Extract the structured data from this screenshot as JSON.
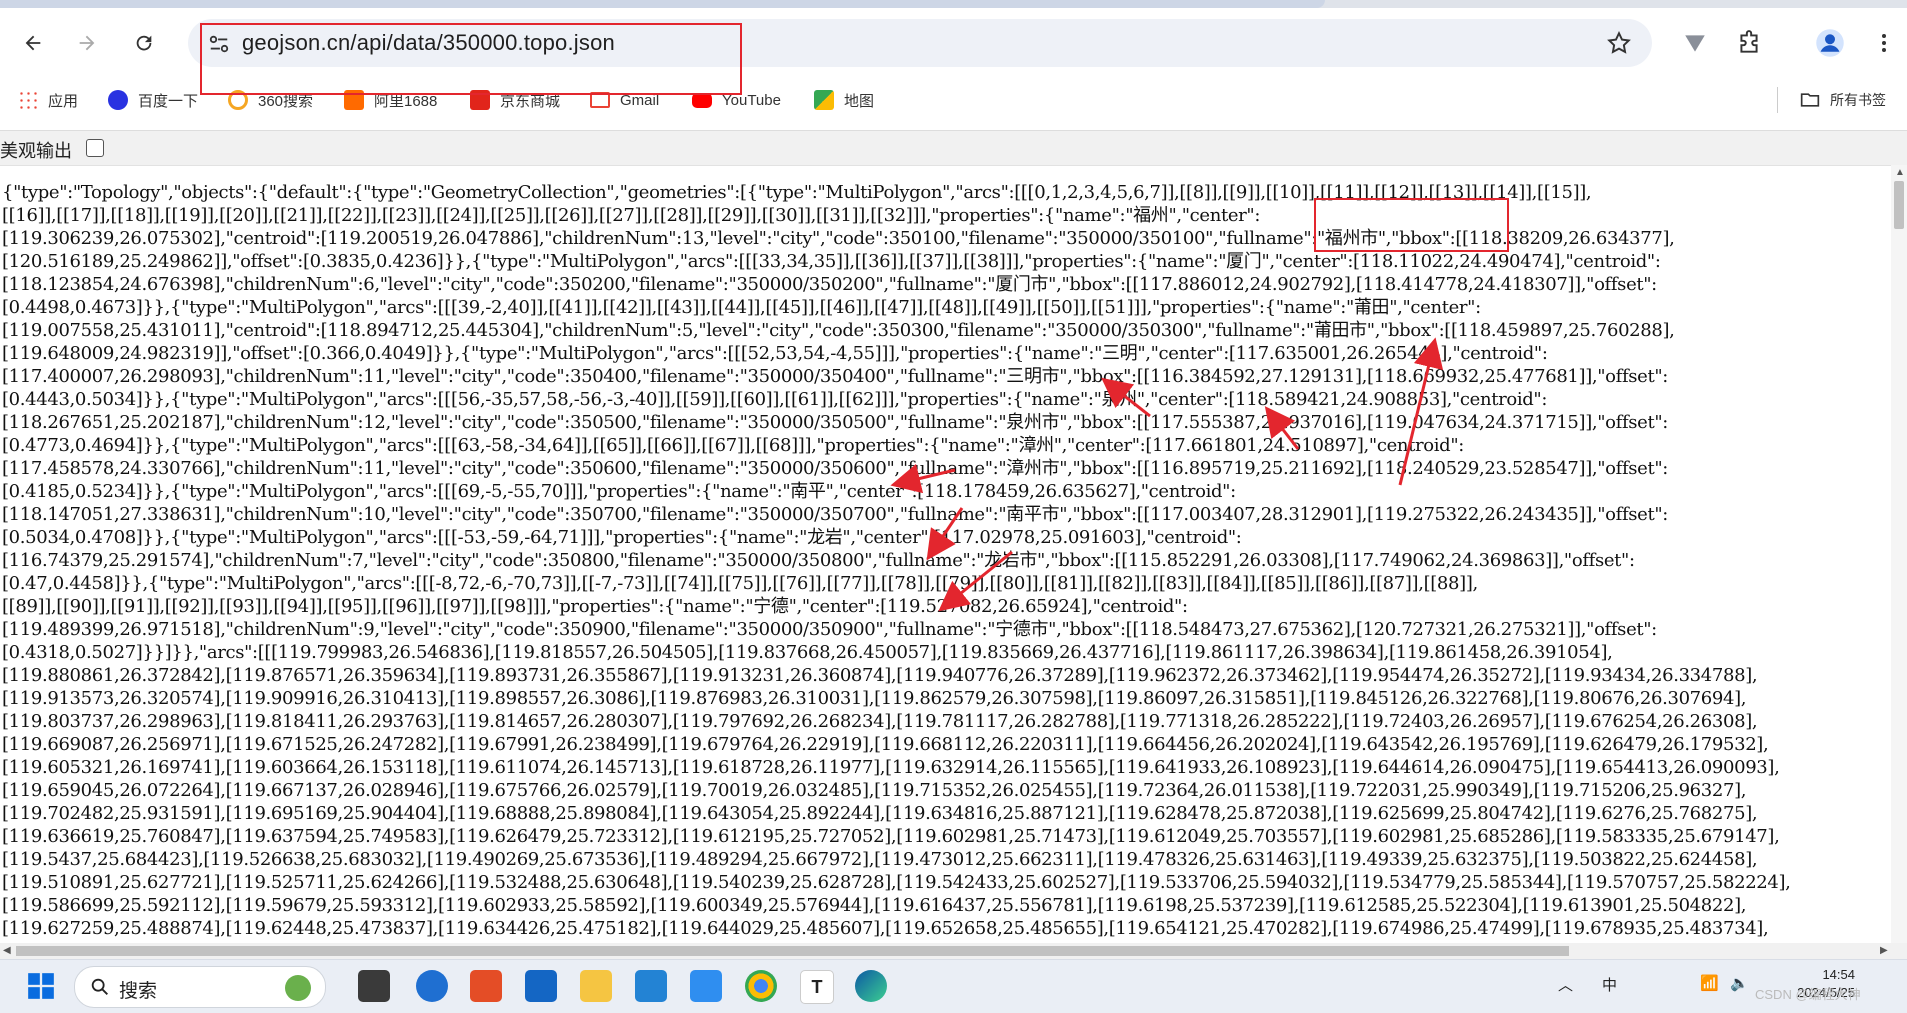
{
  "browser": {
    "url": "geojson.cn/api/data/350000.topo.json"
  },
  "bookmarks": [
    {
      "label": "应用",
      "color": "#4285f4"
    },
    {
      "label": "百度一下",
      "color": "#2932e1"
    },
    {
      "label": "360搜索",
      "color": "#f5a623"
    },
    {
      "label": "阿里1688",
      "color": "#ff6a00"
    },
    {
      "label": "京东商城",
      "color": "#e1251b"
    },
    {
      "label": "Gmail",
      "color": "#ea4335"
    },
    {
      "label": "YouTube",
      "color": "#ff0000"
    },
    {
      "label": "地图",
      "color": "#34a853"
    }
  ],
  "all_bookmarks_label": "所有书签",
  "pretty_print": {
    "label": "美观输出",
    "checked": false
  },
  "json_lines": [
    "{\"type\":\"Topology\",\"objects\":{\"default\":{\"type\":\"GeometryCollection\",\"geometries\":[{\"type\":\"MultiPolygon\",\"arcs\":[[[0,1,2,3,4,5,6,7]],[[8]],[[9]],[[10]],[[11]],[[12]],[[13]],[[14]],[[15]],",
    "[[16]],[[17]],[[18]],[[19]],[[20]],[[21]],[[22]],[[23]],[[24]],[[25]],[[26]],[[27]],[[28]],[[29]],[[30]],[[31]],[[32]]],\"properties\":{\"name\":\"福州\",\"center\":",
    "[119.306239,26.075302],\"centroid\":[119.200519,26.047886],\"childrenNum\":13,\"level\":\"city\",\"code\":350100,\"filename\":\"350000/350100\",\"fullname\":\"福州市\",\"bbox\":[[118.38209,26.634377],",
    "[120.516189,25.249862]],\"offset\":[0.3835,0.4236]}},{\"type\":\"MultiPolygon\",\"arcs\":[[[33,34,35]],[[36]],[[37]],[[38]]],\"properties\":{\"name\":\"厦门\",\"center\":[118.11022,24.490474],\"centroid\":",
    "[118.123854,24.676398],\"childrenNum\":6,\"level\":\"city\",\"code\":350200,\"filename\":\"350000/350200\",\"fullname\":\"厦门市\",\"bbox\":[[117.886012,24.902792],[118.414778,24.418307]],\"offset\":",
    "[0.4498,0.4673]}},{\"type\":\"MultiPolygon\",\"arcs\":[[[39,-2,40]],[[41]],[[42]],[[43]],[[44]],[[45]],[[46]],[[47]],[[48]],[[49]],[[50]],[[51]]],\"properties\":{\"name\":\"莆田\",\"center\":",
    "[119.007558,25.431011],\"centroid\":[118.894712,25.445304],\"childrenNum\":5,\"level\":\"city\",\"code\":350300,\"filename\":\"350000/350300\",\"fullname\":\"莆田市\",\"bbox\":[[118.459897,25.760288],",
    "[119.648009,24.982319]],\"offset\":[0.366,0.4049]}},{\"type\":\"MultiPolygon\",\"arcs\":[[[52,53,54,-4,55]]],\"properties\":{\"name\":\"三明\",\"center\":[117.635001,26.265444],\"centroid\":",
    "[117.400007,26.298093],\"childrenNum\":11,\"level\":\"city\",\"code\":350400,\"filename\":\"350000/350400\",\"fullname\":\"三明市\",\"bbox\":[[116.384592,27.129131],[118.669932,25.477681]],\"offset\":",
    "[0.4443,0.5034]}},{\"type\":\"MultiPolygon\",\"arcs\":[[[56,-35,57,58,-56,-3,-40]],[[59]],[[60]],[[61]],[[62]]],\"properties\":{\"name\":\"泉州\",\"center\":[118.589421,24.908853],\"centroid\":",
    "[118.267651,25.202187],\"childrenNum\":12,\"level\":\"city\",\"code\":350500,\"filename\":\"350000/350500\",\"fullname\":\"泉州市\",\"bbox\":[[117.555387,25.937016],[119.047634,24.371715]],\"offset\":",
    "[0.4773,0.4694]}},{\"type\":\"MultiPolygon\",\"arcs\":[[[63,-58,-34,64]],[[65]],[[66]],[[67]],[[68]]],\"properties\":{\"name\":\"漳州\",\"center\":[117.661801,24.510897],\"centroid\":",
    "[117.458578,24.330766],\"childrenNum\":11,\"level\":\"city\",\"code\":350600,\"filename\":\"350000/350600\",\"fullname\":\"漳州市\",\"bbox\":[[116.895719,25.211692],[118.240529,23.528547]],\"offset\":",
    "[0.4185,0.5234]}},{\"type\":\"MultiPolygon\",\"arcs\":[[[69,-5,-55,70]]],\"properties\":{\"name\":\"南平\",\"center\":[118.178459,26.635627],\"centroid\":",
    "[118.147051,27.338631],\"childrenNum\":10,\"level\":\"city\",\"code\":350700,\"filename\":\"350000/350700\",\"fullname\":\"南平市\",\"bbox\":[[117.003407,28.312901],[119.275322,26.243435]],\"offset\":",
    "[0.5034,0.4708]}},{\"type\":\"MultiPolygon\",\"arcs\":[[[-53,-59,-64,71]]],\"properties\":{\"name\":\"龙岩\",\"center\":[117.02978,25.091603],\"centroid\":",
    "[116.74379,25.291574],\"childrenNum\":7,\"level\":\"city\",\"code\":350800,\"filename\":\"350000/350800\",\"fullname\":\"龙岩市\",\"bbox\":[[115.852291,26.03308],[117.749062,24.369863]],\"offset\":",
    "[0.47,0.4458]}},{\"type\":\"MultiPolygon\",\"arcs\":[[[-8,72,-6,-70,73]],[[-7,-73]],[[74]],[[75]],[[76]],[[77]],[[78]],[[79]],[[80]],[[81]],[[82]],[[83]],[[84]],[[85]],[[86]],[[87]],[[88]],",
    "[[89]],[[90]],[[91]],[[92]],[[93]],[[94]],[[95]],[[96]],[[97]],[[98]]],\"properties\":{\"name\":\"宁德\",\"center\":[119.527082,26.65924],\"centroid\":",
    "[119.489399,26.971518],\"childrenNum\":9,\"level\":\"city\",\"code\":350900,\"filename\":\"350000/350900\",\"fullname\":\"宁德市\",\"bbox\":[[118.548473,27.675362],[120.727321,26.275321]],\"offset\":",
    "[0.4318,0.5027]}}]}},\"arcs\":[[[119.799983,26.546836],[119.818557,26.504505],[119.837668,26.450057],[119.835669,26.437716],[119.861117,26.398634],[119.861458,26.391054],",
    "[119.880861,26.372842],[119.876571,26.359634],[119.893731,26.355867],[119.913231,26.360874],[119.940776,26.37289],[119.962372,26.373462],[119.954474,26.35272],[119.93434,26.334788],",
    "[119.913573,26.320574],[119.909916,26.310413],[119.898557,26.3086],[119.876983,26.310031],[119.862579,26.307598],[119.86097,26.315851],[119.845126,26.322768],[119.80676,26.307694],",
    "[119.803737,26.298963],[119.818411,26.293763],[119.814657,26.280307],[119.797692,26.268234],[119.781117,26.282788],[119.771318,26.285222],[119.72403,26.26957],[119.676254,26.26308],",
    "[119.669087,26.256971],[119.671525,26.247282],[119.67991,26.238499],[119.679764,26.22919],[119.668112,26.220311],[119.664456,26.202024],[119.643542,26.195769],[119.626479,26.179532],",
    "[119.605321,26.169741],[119.603664,26.153118],[119.611074,26.145713],[119.618728,26.11977],[119.632914,26.115565],[119.641933,26.108923],[119.644614,26.090475],[119.654413,26.090093],",
    "[119.659045,26.072264],[119.667137,26.028946],[119.675766,26.02579],[119.70019,26.032485],[119.715352,26.025455],[119.72364,26.011538],[119.722031,25.990349],[119.715206,25.96327],",
    "[119.702482,25.931591],[119.695169,25.904404],[119.68888,25.898084],[119.643054,25.892244],[119.634816,25.887121],[119.628478,25.872038],[119.625699,25.804742],[119.6276,25.768275],",
    "[119.636619,25.760847],[119.637594,25.749583],[119.626479,25.723312],[119.612195,25.727052],[119.602981,25.71473],[119.612049,25.703557],[119.602981,25.685286],[119.583335,25.679147],",
    "[119.5437,25.684423],[119.526638,25.683032],[119.490269,25.673536],[119.489294,25.667972],[119.473012,25.662311],[119.478326,25.631463],[119.49339,25.632375],[119.503822,25.624458],",
    "[119.510891,25.627721],[119.525711,25.624266],[119.532488,25.630648],[119.540239,25.628728],[119.542433,25.602527],[119.533706,25.594032],[119.534779,25.585344],[119.570757,25.582224],",
    "[119.586699,25.592112],[119.59679,25.593312],[119.602933,25.58592],[119.600349,25.576944],[119.616437,25.556781],[119.6198,25.537239],[119.612585,25.522304],[119.613901,25.504822],",
    "[119.627259,25.488874],[119.62448,25.473837],[119.634426,25.475182],[119.644029,25.485607],[119.652658,25.485655],[119.654121,25.470282],[119.674986,25.47499],[119.678935,25.483734],"
  ],
  "taskbar": {
    "search_label": "搜索",
    "ime": "中",
    "time": "14:54",
    "date": "2024/5/25"
  },
  "watermark": "CSDN @编程大神",
  "colors": {
    "annotation_red": "#e3262e"
  }
}
